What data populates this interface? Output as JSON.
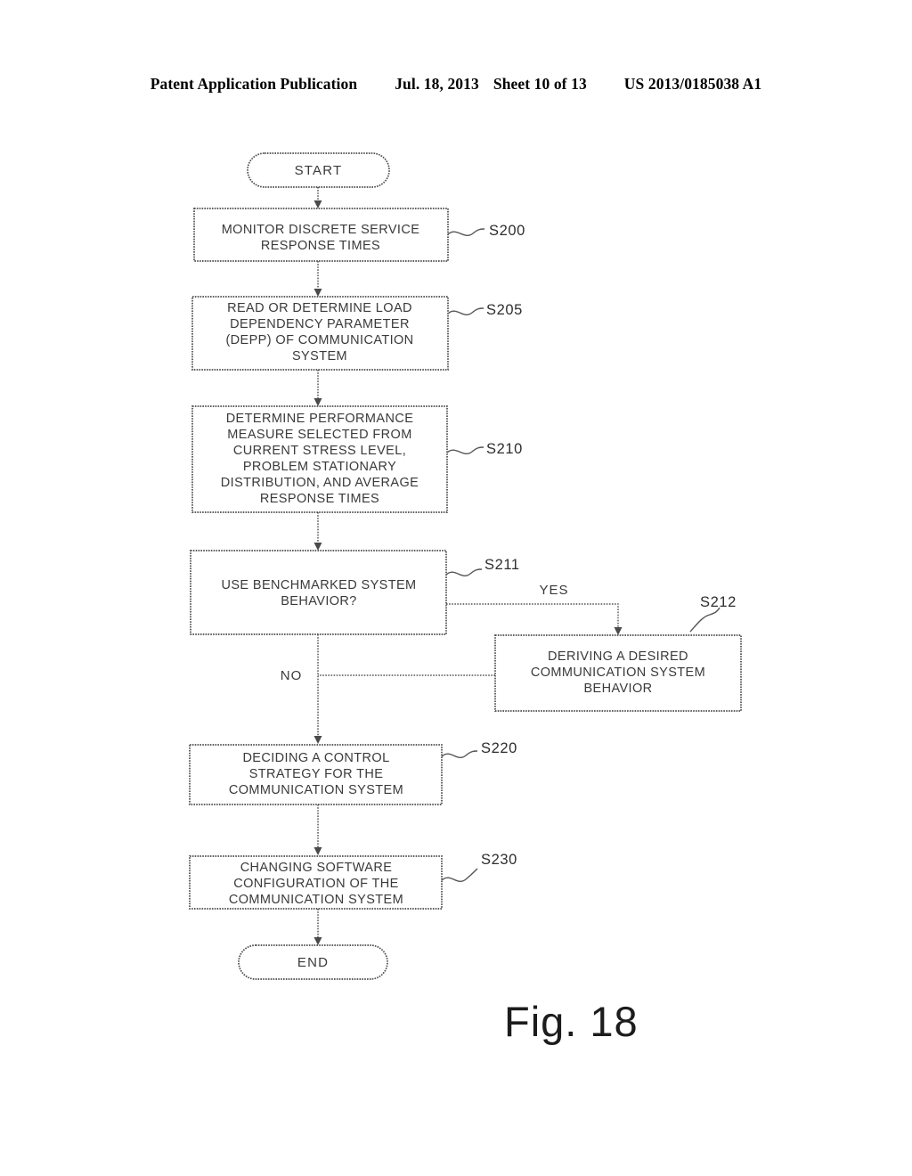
{
  "header": {
    "publication": "Patent Application Publication",
    "date": "Jul. 18, 2013",
    "sheet": "Sheet 10 of 13",
    "number": "US 2013/0185038 A1"
  },
  "figure": {
    "caption": "Fig. 18",
    "nodes": {
      "start": {
        "label": "START"
      },
      "s200": {
        "ref": "S200",
        "lines": [
          "MONITOR DISCRETE SERVICE",
          "RESPONSE TIMES"
        ]
      },
      "s205": {
        "ref": "S205",
        "lines": [
          "READ OR DETERMINE LOAD",
          "DEPENDENCY PARAMETER",
          "(DEPP) OF COMMUNICATION",
          "SYSTEM"
        ]
      },
      "s210": {
        "ref": "S210",
        "lines": [
          "DETERMINE PERFORMANCE",
          "MEASURE SELECTED FROM",
          "CURRENT STRESS LEVEL,",
          "PROBLEM STATIONARY",
          "DISTRIBUTION, AND AVERAGE",
          "RESPONSE TIMES"
        ]
      },
      "s211": {
        "ref": "S211",
        "lines": [
          "USE BENCHMARKED SYSTEM",
          "BEHAVIOR?"
        ]
      },
      "s212": {
        "ref": "S212",
        "lines": [
          "DERIVING A DESIRED",
          "COMMUNICATION SYSTEM",
          "BEHAVIOR"
        ]
      },
      "s220": {
        "ref": "S220",
        "lines": [
          "DECIDING A CONTROL",
          "STRATEGY FOR THE",
          "COMMUNICATION SYSTEM"
        ]
      },
      "s230": {
        "ref": "S230",
        "lines": [
          "CHANGING SOFTWARE",
          "CONFIGURATION OF THE",
          "COMMUNICATION SYSTEM"
        ]
      },
      "end": {
        "label": "END"
      }
    },
    "branches": {
      "yes": "YES",
      "no": "NO"
    }
  },
  "colors": {
    "ink": "#3a3a3a",
    "stroke": "#555555",
    "paper": "#ffffff"
  }
}
